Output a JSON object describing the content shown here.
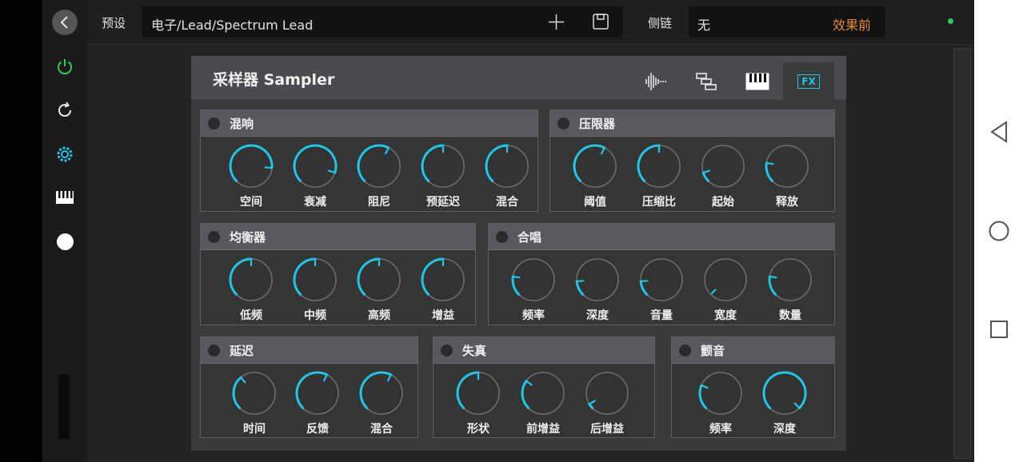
{
  "topbar": {
    "preset_label": "预设",
    "preset_value": "电子/Lead/Spectrum Lead",
    "sidechain_label": "侧链",
    "sidechain_value": "无",
    "sidechain_mode": "效果前"
  },
  "leftbar": {
    "icons": [
      "back-icon",
      "power-icon",
      "refresh-icon",
      "settings-gear-icon",
      "piano-keys-icon",
      "record-dot-icon"
    ]
  },
  "plugin": {
    "title": "采样器 Sampler",
    "tabs": [
      "waveform-icon",
      "routing-icon",
      "piano-keys-icon",
      "FX"
    ],
    "active_tab": "FX",
    "panels": [
      {
        "key": "reverb",
        "title": "混响",
        "knobs": [
          {
            "label": "空间",
            "value": 0.85
          },
          {
            "label": "衰减",
            "value": 0.9
          },
          {
            "label": "阻尼",
            "value": 0.6
          },
          {
            "label": "预延迟",
            "value": 0.5
          },
          {
            "label": "混合",
            "value": 0.5
          }
        ]
      },
      {
        "key": "limiter",
        "title": "压限器",
        "knobs": [
          {
            "label": "阈值",
            "value": 0.6
          },
          {
            "label": "压缩比",
            "value": 0.5
          },
          {
            "label": "起始",
            "value": 0.1
          },
          {
            "label": "释放",
            "value": 0.2
          }
        ]
      },
      {
        "key": "eq",
        "title": "均衡器",
        "knobs": [
          {
            "label": "低频",
            "value": 0.5
          },
          {
            "label": "中频",
            "value": 0.5
          },
          {
            "label": "高频",
            "value": 0.5
          },
          {
            "label": "增益",
            "value": 0.5
          }
        ]
      },
      {
        "key": "chorus",
        "title": "合唱",
        "knobs": [
          {
            "label": "频率",
            "value": 0.2
          },
          {
            "label": "深度",
            "value": 0.15
          },
          {
            "label": "音量",
            "value": 0.15
          },
          {
            "label": "宽度",
            "value": 0.0
          },
          {
            "label": "数量",
            "value": 0.2
          }
        ]
      },
      {
        "key": "delay",
        "title": "延迟",
        "knobs": [
          {
            "label": "时间",
            "value": 0.35
          },
          {
            "label": "反馈",
            "value": 0.6
          },
          {
            "label": "混合",
            "value": 0.6
          }
        ]
      },
      {
        "key": "distortion",
        "title": "失真",
        "knobs": [
          {
            "label": "形状",
            "value": 0.5
          },
          {
            "label": "前增益",
            "value": 0.3
          },
          {
            "label": "后增益",
            "value": 0.05
          }
        ]
      },
      {
        "key": "tremolo",
        "title": "颤音",
        "knobs": [
          {
            "label": "频率",
            "value": 0.25
          },
          {
            "label": "深度",
            "value": 1.0
          }
        ]
      }
    ]
  },
  "colors": {
    "accent": "#1ec8e6",
    "power": "#2ecc5a",
    "sidechain_mode": "#e08a2e",
    "status_dot": "#2ecc5a"
  },
  "android_nav": [
    "back-triangle-icon",
    "home-circle-icon",
    "recents-square-icon"
  ]
}
